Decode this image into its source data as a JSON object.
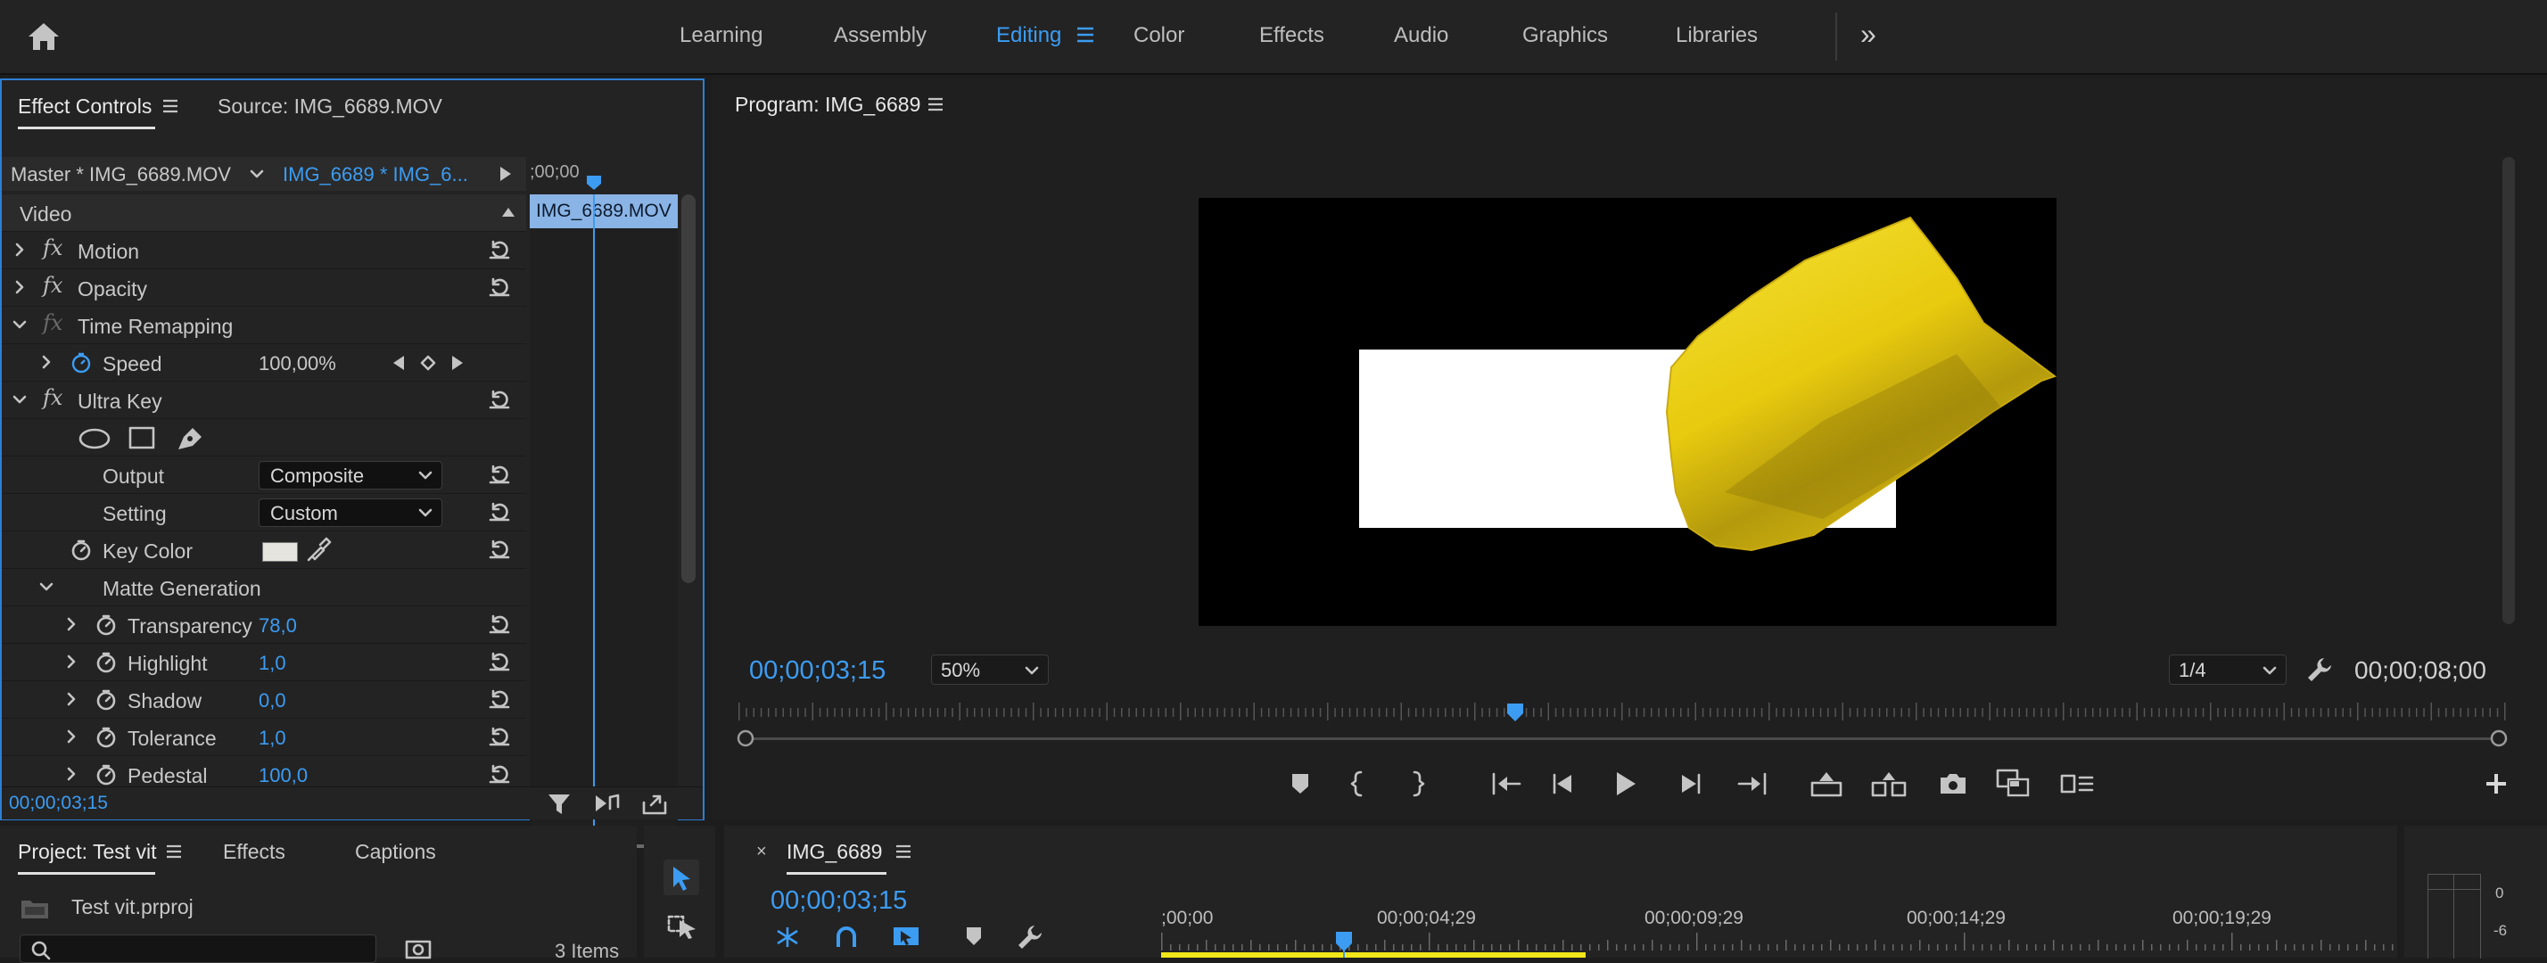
{
  "topbar": {
    "workspaces": [
      "Learning",
      "Assembly",
      "Editing",
      "Color",
      "Effects",
      "Audio",
      "Graphics",
      "Libraries"
    ],
    "active_workspace": "Editing",
    "more_label": "»"
  },
  "effect_controls": {
    "tab_title": "Effect Controls",
    "source_tab": "Source: IMG_6689.MOV",
    "master_clip": "Master * IMG_6689.MOV",
    "sequence_clip": "IMG_6689 * IMG_6...",
    "ruler_time": ";00;00",
    "clip_bar_label": "IMG_6689.MOV",
    "section": "Video",
    "effects": {
      "motion": "Motion",
      "opacity": "Opacity",
      "time_remapping": "Time Remapping",
      "speed_label": "Speed",
      "speed_value": "100,00%",
      "ultra_key": "Ultra Key",
      "output_label": "Output",
      "output_value": "Composite",
      "setting_label": "Setting",
      "setting_value": "Custom",
      "key_color_label": "Key Color",
      "key_color": "#e6e4df",
      "matte_generation": "Matte Generation",
      "params": [
        {
          "label": "Transparency",
          "value": "78,0"
        },
        {
          "label": "Highlight",
          "value": "1,0"
        },
        {
          "label": "Shadow",
          "value": "0,0"
        },
        {
          "label": "Tolerance",
          "value": "1,0"
        },
        {
          "label": "Pedestal",
          "value": "100,0"
        }
      ]
    },
    "timecode": "00;00;03;15"
  },
  "program": {
    "title": "Program: IMG_6689",
    "timecode": "00;00;03;15",
    "zoom": "50%",
    "resolution": "1/4",
    "duration": "00;00;08;00",
    "playhead_fraction": 0.44
  },
  "project": {
    "title": "Project: Test vit",
    "tabs": [
      "Effects",
      "Captions"
    ],
    "file": "Test vit.prproj",
    "items_count": "3 Items"
  },
  "timeline": {
    "sequence": "IMG_6689",
    "timecode": "00;00;03;15",
    "ruler_labels": [
      ";00;00",
      "00;00;04;29",
      "00;00;09;29",
      "00;00;14;29",
      "00;00;19;29"
    ]
  },
  "audio_meter": {
    "labels": [
      "0",
      "-6"
    ]
  },
  "colors": {
    "accent": "#3c9cf2",
    "clip_yellow": "#f1e61a",
    "panel_focus": "#2e7fd3"
  }
}
